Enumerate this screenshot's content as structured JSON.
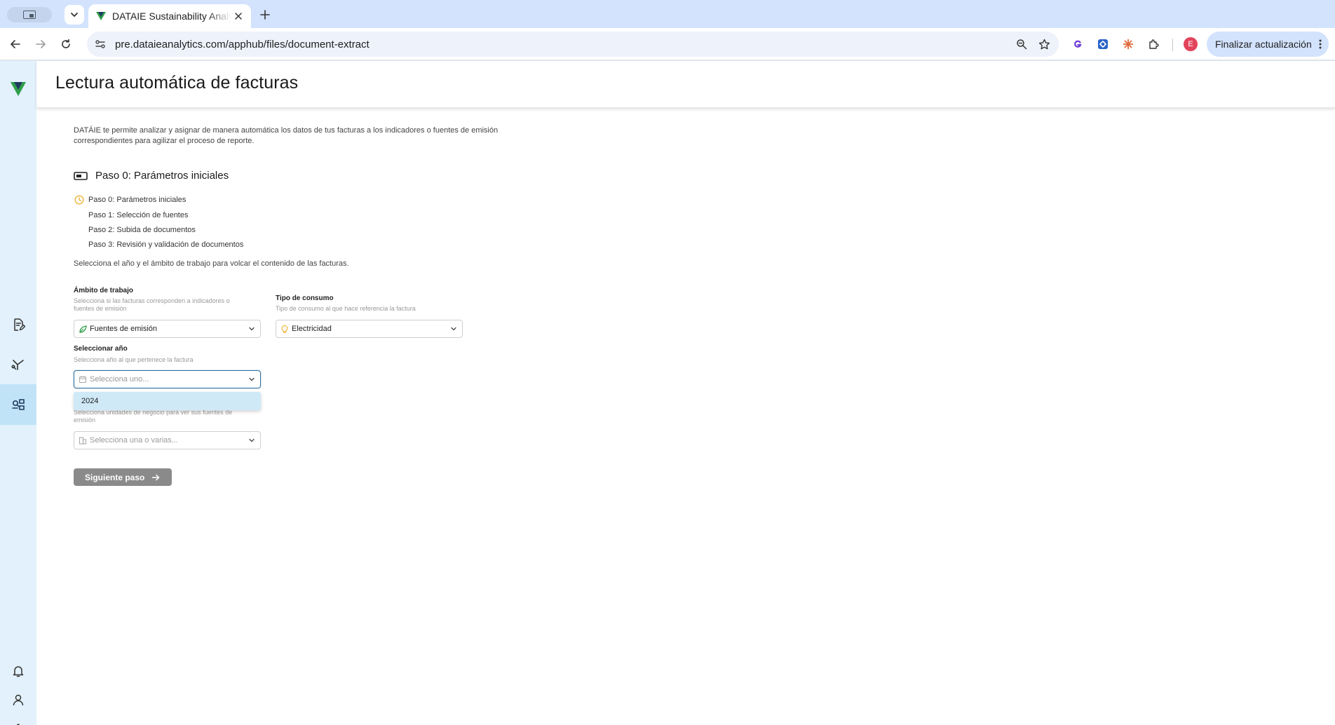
{
  "browser": {
    "tab_title": "DATAIE Sustainability Analytics",
    "url": "pre.dataieanalytics.com/apphub/files/document-extract",
    "update_button": "Finalizar actualización",
    "avatar_letter": "E"
  },
  "page": {
    "title": "Lectura automática de facturas",
    "intro": "DATÁIE te permite analizar y asignar de manera automática los datos de tus facturas a los indicadores o fuentes de emisión correspondientes para agilizar el proceso de reporte.",
    "step_heading": "Paso 0: Parámetros iniciales",
    "steps": [
      "Paso 0: Parámetros iniciales",
      "Paso 1: Selección de fuentes",
      "Paso 2: Subida de documentos",
      "Paso 3: Revisión y validación de documentos"
    ],
    "helper": "Selecciona el año y el ámbito de trabajo para volcar el contenido de las facturas."
  },
  "form": {
    "scope": {
      "label": "Ámbito de trabajo",
      "description": "Selecciona si las facturas corresponden a indicadores o fuentes de emisión",
      "value": "Fuentes de emisión"
    },
    "consumption": {
      "label": "Tipo de consumo",
      "description": "Tipo de consumo al que hace referencia la factura",
      "value": "Electricidad"
    },
    "year": {
      "label": "Seleccionar año",
      "description": "Selecciona año al que pertenece la factura",
      "placeholder": "Selecciona uno...",
      "options": [
        "2024"
      ]
    },
    "business_units": {
      "description": "Selecciona unidades de negocio para ver sus fuentes de emisión",
      "placeholder": "Selecciona una o varias..."
    },
    "next_button": "Siguiente paso"
  },
  "colors": {
    "sidebar_bg": "#e2f1fb",
    "sidebar_active": "#c0e3f7",
    "brand_green": "#2f9e4a",
    "brand_navy": "#1f3a5f",
    "pending_step": "#f0b43c",
    "disabled_button": "#8a8a8a"
  }
}
